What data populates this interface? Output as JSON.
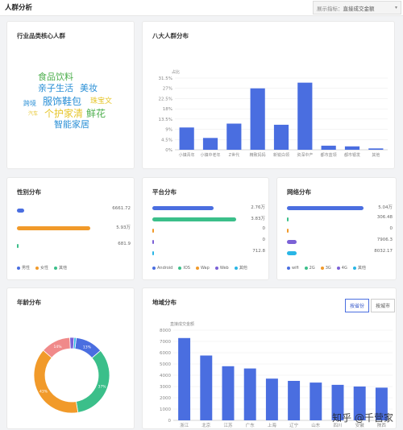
{
  "header": {
    "title": "人群分析",
    "metric_label": "展示指标：",
    "metric_value": "直接成交金额"
  },
  "cards": {
    "industry": {
      "title": "行业品类核心人群"
    },
    "eight": {
      "title": "八大人群分布"
    },
    "gender": {
      "title": "性别分布"
    },
    "platform": {
      "title": "平台分布"
    },
    "network": {
      "title": "网络分布"
    },
    "age": {
      "title": "年龄分布"
    },
    "region": {
      "title": "地域分布",
      "btn_province": "按省份",
      "btn_city": "按城市"
    }
  },
  "wordcloud": {
    "words": [
      {
        "text": "食品饮料",
        "color": "#4cae4c"
      },
      {
        "text": "亲子生活",
        "color": "#2a8fd6"
      },
      {
        "text": "美妆",
        "color": "#2a8fd6"
      },
      {
        "text": "跨境",
        "color": "#2a8fd6"
      },
      {
        "text": "服饰鞋包",
        "color": "#2a8fd6"
      },
      {
        "text": "珠宝文",
        "color": "#e6c52a"
      },
      {
        "text": "汽车",
        "color": "#e6c52a"
      },
      {
        "text": "个护家清",
        "color": "#e6c52a"
      },
      {
        "text": "鲜花",
        "color": "#4cae4c"
      },
      {
        "text": "智能家居",
        "color": "#2a8fd6"
      }
    ]
  },
  "gender": {
    "rows": [
      {
        "value": "6661.72",
        "ratio": 0.08,
        "color": "#4a6ee0"
      },
      {
        "value": "5.93万",
        "ratio": 0.85,
        "color": "#f19a2a"
      },
      {
        "value": "681.9",
        "ratio": 0.01,
        "color": "#3bbf8a"
      }
    ],
    "legend": [
      {
        "label": "男性",
        "color": "#4a6ee0"
      },
      {
        "label": "女性",
        "color": "#f19a2a"
      },
      {
        "label": "其他",
        "color": "#3bbf8a"
      }
    ]
  },
  "platform": {
    "rows": [
      {
        "value": "2.76万",
        "ratio": 0.72,
        "color": "#4a6ee0"
      },
      {
        "value": "3.83万",
        "ratio": 0.98,
        "color": "#3bbf8a"
      },
      {
        "value": "0",
        "ratio": 0.0,
        "color": "#f19a2a"
      },
      {
        "value": "0",
        "ratio": 0.0,
        "color": "#7b61d6"
      },
      {
        "value": "712.8",
        "ratio": 0.01,
        "color": "#29b6e6"
      }
    ],
    "legend": [
      {
        "label": "Android",
        "color": "#4a6ee0"
      },
      {
        "label": "IOS",
        "color": "#3bbf8a"
      },
      {
        "label": "Wap",
        "color": "#f19a2a"
      },
      {
        "label": "Web",
        "color": "#7b61d6"
      },
      {
        "label": "其他",
        "color": "#29b6e6"
      }
    ]
  },
  "network": {
    "rows": [
      {
        "value": "5.04万",
        "ratio": 0.98,
        "color": "#4a6ee0"
      },
      {
        "value": "306.48",
        "ratio": 0.01,
        "color": "#3bbf8a"
      },
      {
        "value": "0",
        "ratio": 0.0,
        "color": "#f19a2a"
      },
      {
        "value": "7906.3",
        "ratio": 0.12,
        "color": "#7b61d6"
      },
      {
        "value": "8032.17",
        "ratio": 0.12,
        "color": "#29b6e6"
      }
    ],
    "legend": [
      {
        "label": "wifi",
        "color": "#4a6ee0"
      },
      {
        "label": "2G",
        "color": "#3bbf8a"
      },
      {
        "label": "3G",
        "color": "#f19a2a"
      },
      {
        "label": "4G",
        "color": "#7b61d6"
      },
      {
        "label": "其他",
        "color": "#29b6e6"
      }
    ]
  },
  "chart_data": [
    {
      "type": "bar",
      "ylabel": "占比",
      "categories": [
        "小镇青年",
        "小镇中老年",
        "Z世代",
        "精致妈妈",
        "新锐白领",
        "资深中产",
        "都市蓝领",
        "都市银发",
        "其他"
      ],
      "values": [
        9.8,
        5.2,
        11.5,
        27.0,
        11.0,
        29.5,
        1.8,
        1.5,
        0.6
      ],
      "yticks": [
        "0%",
        "4.5%",
        "9%",
        "13.5%",
        "18%",
        "22.5%",
        "27%",
        "31.5%"
      ],
      "ylim": [
        0,
        31.5
      ],
      "color": "#4a6ee0"
    },
    {
      "type": "pie",
      "labels": [
        "13%",
        "37%",
        "43%",
        "14%"
      ],
      "values": [
        13,
        37,
        43,
        14
      ],
      "colors": [
        "#4a6ee0",
        "#3bbf8a",
        "#f19a2a",
        "#f08a8a"
      ],
      "extra_segments": [
        {
          "value": 2,
          "color": "#7b61d6"
        },
        {
          "value": 1,
          "color": "#29b6e6"
        }
      ]
    },
    {
      "type": "bar",
      "ylabel": "直接成交金额",
      "categories": [
        "浙江",
        "北京",
        "江苏",
        "广东",
        "上海",
        "辽宁",
        "山东",
        "四川",
        "安徽",
        "陕西"
      ],
      "values": [
        7300,
        5750,
        4800,
        4600,
        3700,
        3500,
        3350,
        3150,
        3000,
        2900
      ],
      "yticks": [
        "0",
        "1000",
        "2000",
        "3000",
        "4000",
        "5000",
        "6000",
        "7000",
        "8000"
      ],
      "ylim": [
        0,
        8000
      ],
      "color": "#4a6ee0"
    }
  ],
  "watermark": "知乎 @千营家"
}
